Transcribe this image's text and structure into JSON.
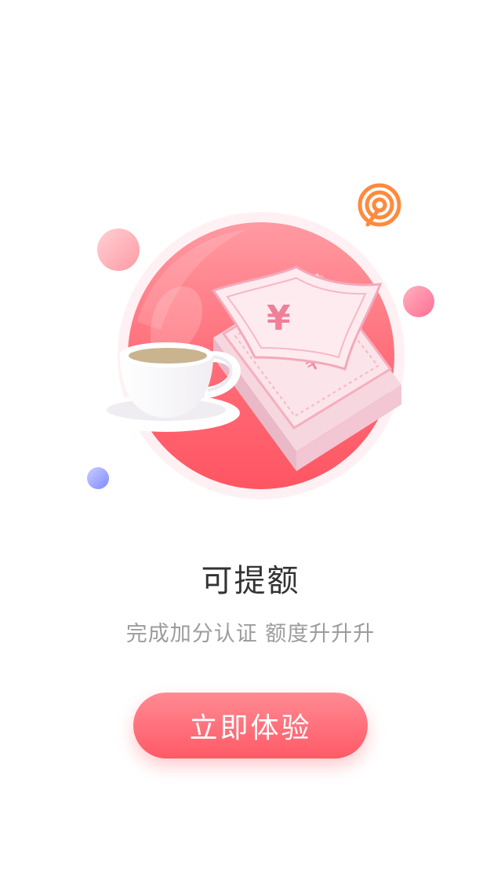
{
  "illustration": {
    "icons": [
      "coffee-cup-icon",
      "money-stack-icon",
      "signal-icon"
    ],
    "colors": {
      "main_circle": "#ff6b76",
      "signal": "#ff8a3d",
      "dot_pink": "#ff88a6",
      "dot_blue": "#8d96ff"
    }
  },
  "content": {
    "title": "可提额",
    "subtitle": "完成加分认证 额度升升升"
  },
  "cta": {
    "label": "立即体验",
    "color": "#ff6470"
  }
}
